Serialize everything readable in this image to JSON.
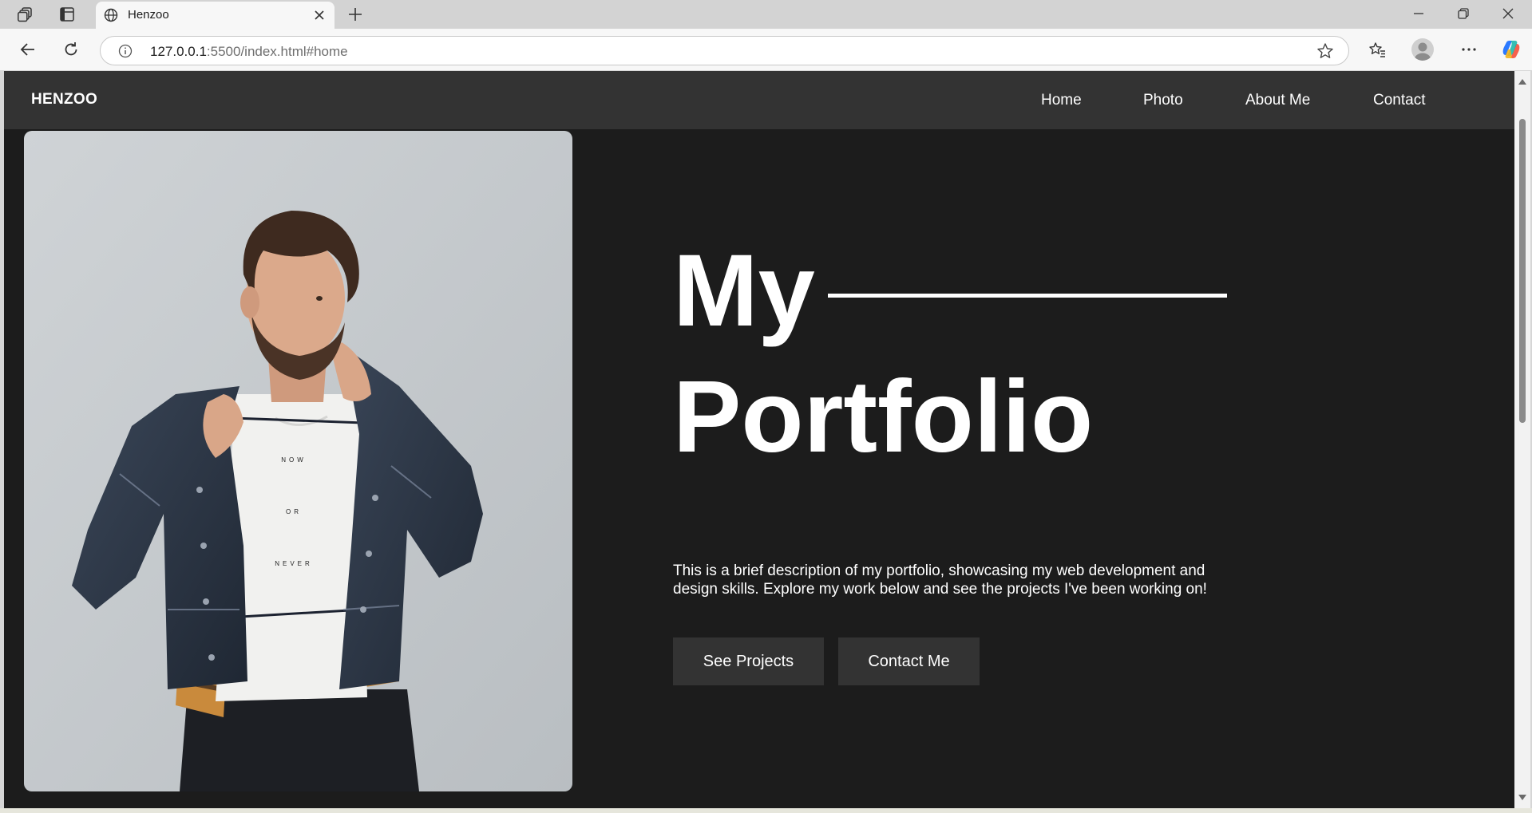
{
  "browser": {
    "tab_title": "Henzoo",
    "url_host": "127.0.0.1",
    "url_rest": ":5500/index.html#home"
  },
  "site": {
    "brand": "HENZOO",
    "nav": [
      "Home",
      "Photo",
      "About Me",
      "Contact"
    ],
    "hero_word1": "My",
    "hero_word2": "Portfolio",
    "description": "This is a brief description of my portfolio, showcasing my web development and design skills. Explore my work below and see the projects I've been working on!",
    "buttons": [
      "See Projects",
      "Contact Me"
    ],
    "photo_shirt_text": [
      "NOW",
      "OR",
      "NEVER"
    ]
  },
  "colors": {
    "page_bg": "#1c1c1c",
    "nav_bg": "#333333",
    "button_bg": "#333333",
    "text": "#ffffff"
  }
}
